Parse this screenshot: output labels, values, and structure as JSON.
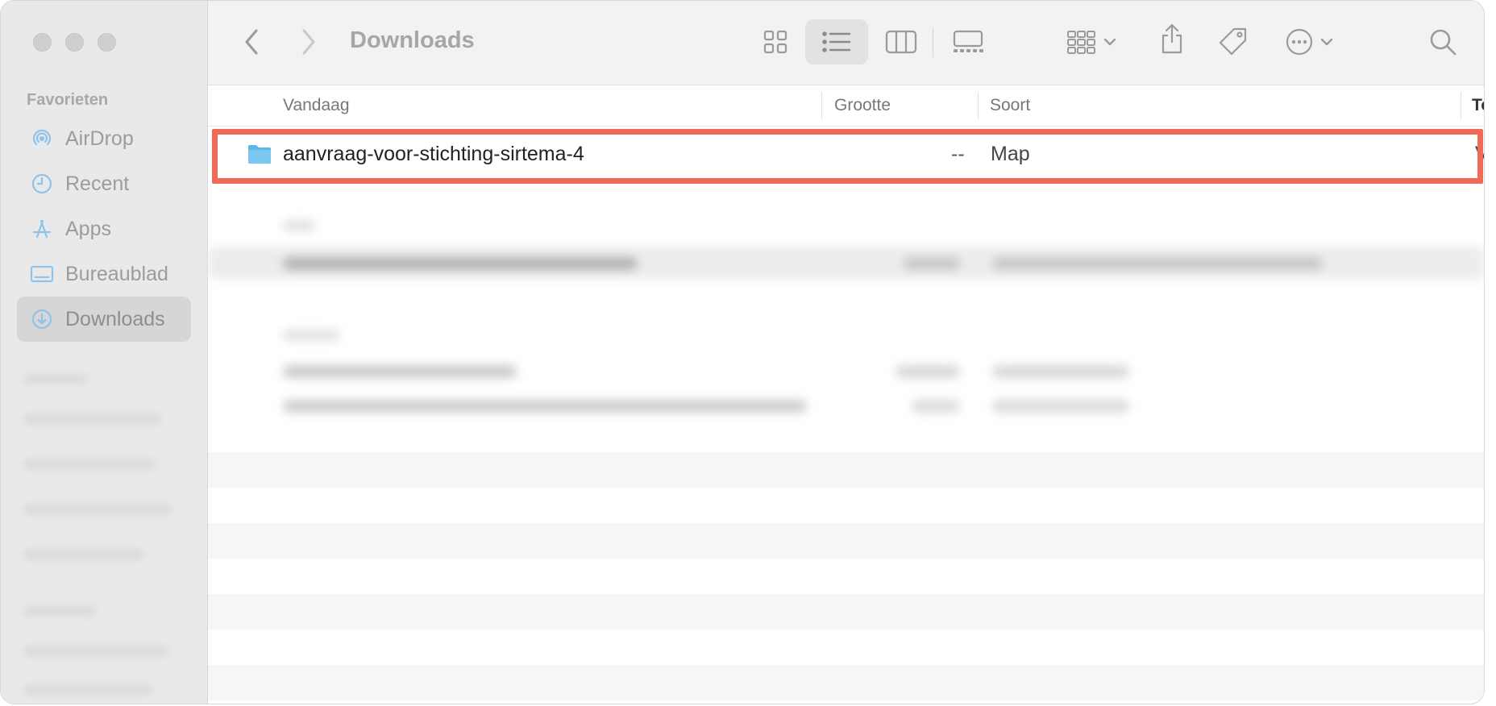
{
  "window": {
    "title": "Downloads"
  },
  "sidebar": {
    "section_favorites": "Favorieten",
    "items": [
      {
        "label": "AirDrop",
        "icon": "airdrop-icon"
      },
      {
        "label": "Recent",
        "icon": "clock-icon"
      },
      {
        "label": "Apps",
        "icon": "apps-icon"
      },
      {
        "label": "Bureaublad",
        "icon": "desktop-icon"
      },
      {
        "label": "Downloads",
        "icon": "download-icon",
        "selected": true
      }
    ]
  },
  "toolbar": {
    "back": "chevron-left-icon",
    "forward": "chevron-right-icon",
    "views": [
      "icon-view-icon",
      "list-view-icon",
      "column-view-icon",
      "gallery-view-icon"
    ],
    "active_view": "list-view-icon",
    "actions": [
      "group-icon",
      "share-icon",
      "tag-icon",
      "more-icon",
      "search-icon"
    ]
  },
  "columns": {
    "name": "Vandaag",
    "size": "Grootte",
    "kind": "Soort",
    "extra": "To"
  },
  "rows": [
    {
      "name": "aanvraag-voor-stichting-sirtema-4",
      "size": "--",
      "kind": "Map",
      "extra": "V",
      "icon": "folder-icon"
    }
  ],
  "colors": {
    "highlight": "#f06a55",
    "folder": "#5fb4ea",
    "sidebar_icon": "#8fc3ea"
  }
}
